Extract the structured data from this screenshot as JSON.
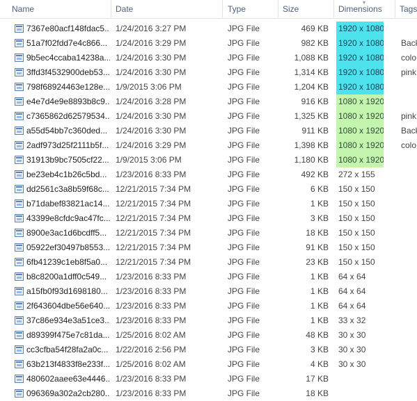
{
  "columns": {
    "name": "Name",
    "date": "Date",
    "type": "Type",
    "size": "Size",
    "dimensions": "Dimensions",
    "tags": "Tags",
    "sort_icon": "sort-descending-icon"
  },
  "colors": {
    "landscape_highlight": "#4de2ee",
    "portrait_highlight": "#c4f5ae"
  },
  "files": [
    {
      "name": "7367e80acf148fdac5...",
      "date": "1/24/2016 3:27 PM",
      "type": "JPG File",
      "size": "469 KB",
      "dims": "1920 x 1080",
      "tags": "",
      "highlight": "cyan"
    },
    {
      "name": "51a7f02fdd7e4c866...",
      "date": "1/24/2016 3:29 PM",
      "type": "JPG File",
      "size": "982 KB",
      "dims": "1920 x 1080",
      "tags": "Back",
      "highlight": "cyan"
    },
    {
      "name": "9b5ec4ccaba14238a...",
      "date": "1/24/2016 3:30 PM",
      "type": "JPG File",
      "size": "1,088 KB",
      "dims": "1920 x 1080",
      "tags": "colo",
      "highlight": "cyan"
    },
    {
      "name": "3ffd3f4532900deb53...",
      "date": "1/24/2016 3:30 PM",
      "type": "JPG File",
      "size": "1,314 KB",
      "dims": "1920 x 1080",
      "tags": "pink",
      "highlight": "cyan"
    },
    {
      "name": "798f68924463e128e...",
      "date": "1/9/2015 3:06 PM",
      "type": "JPG File",
      "size": "1,204 KB",
      "dims": "1920 x 1080",
      "tags": "",
      "highlight": "cyan"
    },
    {
      "name": "e4e7d4e9e8893b8c9...",
      "date": "1/24/2016 3:28 PM",
      "type": "JPG File",
      "size": "916 KB",
      "dims": "1080 x 1920",
      "tags": "",
      "highlight": "green"
    },
    {
      "name": "c7365862d62579534...",
      "date": "1/24/2016 3:30 PM",
      "type": "JPG File",
      "size": "1,325 KB",
      "dims": "1080 x 1920",
      "tags": "pink",
      "highlight": "green"
    },
    {
      "name": "a55d54bb7c360ded...",
      "date": "1/24/2016 3:30 PM",
      "type": "JPG File",
      "size": "911 KB",
      "dims": "1080 x 1920",
      "tags": "Back",
      "highlight": "green"
    },
    {
      "name": "2adf973d25f2111b5f...",
      "date": "1/24/2016 3:29 PM",
      "type": "JPG File",
      "size": "1,398 KB",
      "dims": "1080 x 1920",
      "tags": "colo",
      "highlight": "green"
    },
    {
      "name": "31913b9bc7505cf22...",
      "date": "1/9/2015 3:06 PM",
      "type": "JPG File",
      "size": "1,180 KB",
      "dims": "1080 x 1920",
      "tags": "",
      "highlight": "green"
    },
    {
      "name": "be23eb4c1b26c5bd...",
      "date": "1/23/2016 8:33 PM",
      "type": "JPG File",
      "size": "492 KB",
      "dims": "272 x 155",
      "tags": "",
      "highlight": ""
    },
    {
      "name": "dd2561c3a8b59f68c...",
      "date": "12/21/2015 7:34 PM",
      "type": "JPG File",
      "size": "6 KB",
      "dims": "150 x 150",
      "tags": "",
      "highlight": ""
    },
    {
      "name": "b71dabef83821ac14...",
      "date": "12/21/2015 7:34 PM",
      "type": "JPG File",
      "size": "1 KB",
      "dims": "150 x 150",
      "tags": "",
      "highlight": ""
    },
    {
      "name": "43399e8cfdc9ac47fc...",
      "date": "12/21/2015 7:34 PM",
      "type": "JPG File",
      "size": "3 KB",
      "dims": "150 x 150",
      "tags": "",
      "highlight": ""
    },
    {
      "name": "8900e3ac1d6bcdff5...",
      "date": "12/21/2015 7:34 PM",
      "type": "JPG File",
      "size": "18 KB",
      "dims": "150 x 150",
      "tags": "",
      "highlight": ""
    },
    {
      "name": "05922ef30497b8553...",
      "date": "12/21/2015 7:34 PM",
      "type": "JPG File",
      "size": "91 KB",
      "dims": "150 x 150",
      "tags": "",
      "highlight": ""
    },
    {
      "name": "6fb41239c1eb8f5a0...",
      "date": "12/21/2015 7:34 PM",
      "type": "JPG File",
      "size": "23 KB",
      "dims": "150 x 150",
      "tags": "",
      "highlight": ""
    },
    {
      "name": "b8c8200a1dff0c549...",
      "date": "1/23/2016 8:33 PM",
      "type": "JPG File",
      "size": "1 KB",
      "dims": "64 x 64",
      "tags": "",
      "highlight": ""
    },
    {
      "name": "a15fb0f93d1698180...",
      "date": "1/23/2016 8:33 PM",
      "type": "JPG File",
      "size": "1 KB",
      "dims": "64 x 64",
      "tags": "",
      "highlight": ""
    },
    {
      "name": "2f643604dbe56e640...",
      "date": "1/23/2016 8:33 PM",
      "type": "JPG File",
      "size": "1 KB",
      "dims": "64 x 64",
      "tags": "",
      "highlight": ""
    },
    {
      "name": "37c86e934e3a51ce3...",
      "date": "1/23/2016 8:33 PM",
      "type": "JPG File",
      "size": "1 KB",
      "dims": "33 x 32",
      "tags": "",
      "highlight": ""
    },
    {
      "name": "d89399f475e7c81da...",
      "date": "1/25/2016 8:02 AM",
      "type": "JPG File",
      "size": "48 KB",
      "dims": "30 x 30",
      "tags": "",
      "highlight": ""
    },
    {
      "name": "cc3cfba54f28fa2a0c...",
      "date": "1/22/2016 2:56 PM",
      "type": "JPG File",
      "size": "3 KB",
      "dims": "30 x 30",
      "tags": "",
      "highlight": ""
    },
    {
      "name": "63b213f4833f8e233f...",
      "date": "1/25/2016 8:02 AM",
      "type": "JPG File",
      "size": "4 KB",
      "dims": "30 x 30",
      "tags": "",
      "highlight": ""
    },
    {
      "name": "480602aaee63e4446...",
      "date": "1/23/2016 8:33 PM",
      "type": "JPG File",
      "size": "17 KB",
      "dims": "",
      "tags": "",
      "highlight": ""
    },
    {
      "name": "096369a302a2cb280...",
      "date": "1/23/2016 8:33 PM",
      "type": "JPG File",
      "size": "18 KB",
      "dims": "",
      "tags": "",
      "highlight": ""
    }
  ]
}
